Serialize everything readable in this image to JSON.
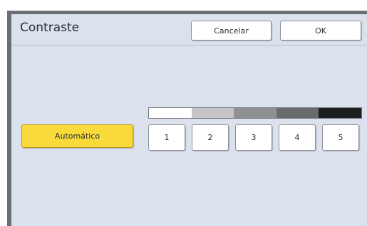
{
  "dialog": {
    "title": "Contraste",
    "cancel_label": "Cancelar",
    "ok_label": "OK"
  },
  "auto": {
    "label": "Automático",
    "color": "#f9da3a"
  },
  "scale": {
    "colors": [
      "#ffffff",
      "#c6c4c6",
      "#8e9091",
      "#6a6b6c",
      "#1b1e1d"
    ]
  },
  "levels": [
    {
      "label": "1"
    },
    {
      "label": "2"
    },
    {
      "label": "3"
    },
    {
      "label": "4"
    },
    {
      "label": "5"
    }
  ]
}
